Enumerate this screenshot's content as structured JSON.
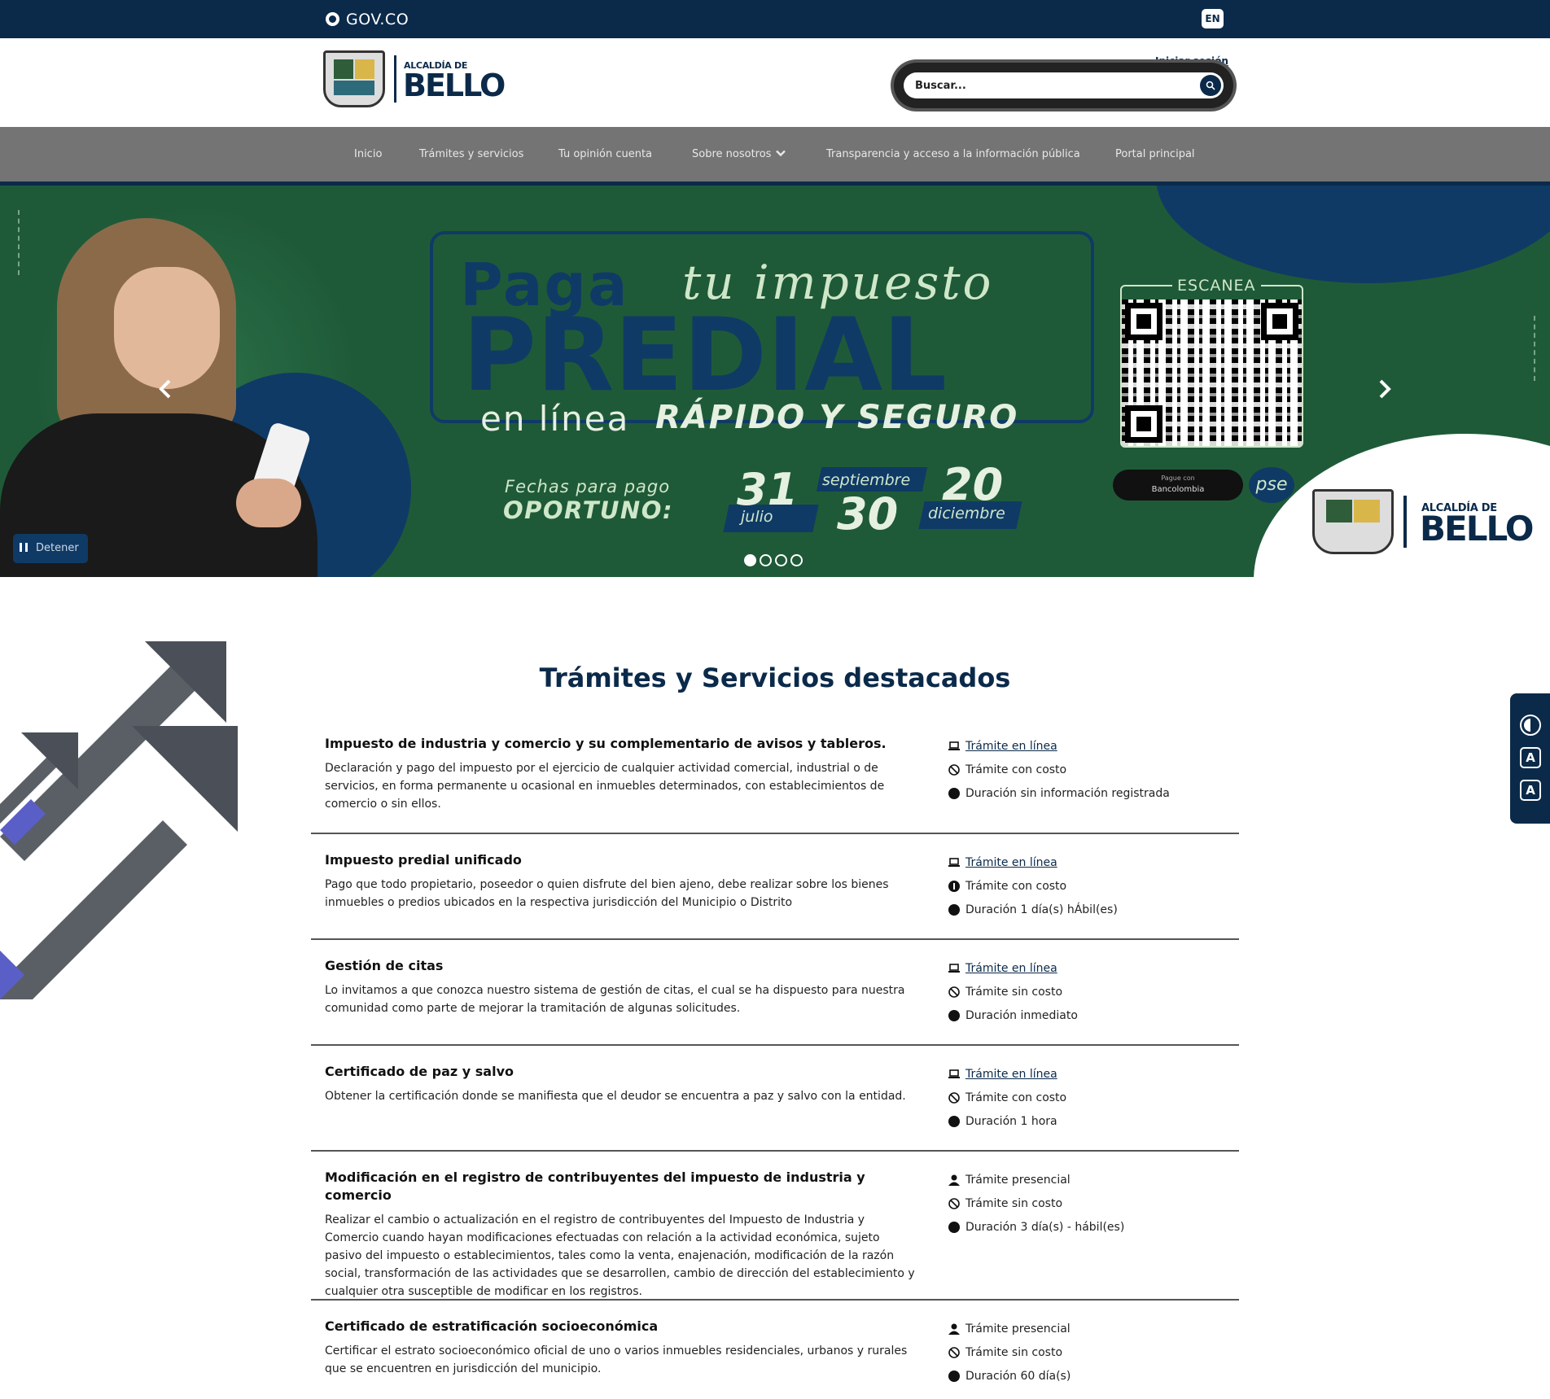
{
  "topbar": {
    "gov_label": "GOV.CO",
    "lang_label": "EN"
  },
  "header": {
    "brand_small": "ALCALDÍA DE",
    "brand_big": "BELLO",
    "login_label": "Iniciar sesión",
    "search_placeholder": "Buscar..."
  },
  "nav": {
    "items": [
      {
        "label": "Inicio"
      },
      {
        "label": "Trámites y servicios"
      },
      {
        "label": "Tu opinión cuenta"
      },
      {
        "label": "Sobre nosotros",
        "has_dropdown": true
      },
      {
        "label": "Transparencia y acceso a la información pública"
      },
      {
        "label": "Portal principal"
      }
    ]
  },
  "hero": {
    "headline_1": "Paga",
    "headline_2": "tu impuesto",
    "headline_3": "PREDIAL",
    "headline_4": "en línea",
    "headline_5": "RÁPIDO Y SEGURO",
    "dates_label_1": "Fechas para pago",
    "dates_label_2": "OPORTUNO:",
    "date_1_day": "31",
    "date_1_month": "julio",
    "date_2_month": "septiembre",
    "date_2_day": "30",
    "date_3_day": "20",
    "date_3_month": "diciembre",
    "qr_label": "ESCANEA",
    "pay_with": "Pague con",
    "bank": "Bancolombia",
    "pse": "pse",
    "brand_small": "ALCALDÍA DE",
    "brand_big": "BELLO",
    "pause_label": "Detener",
    "slides_total": 4,
    "slide_active": 1
  },
  "main": {
    "section_title": "Trámites y Servicios destacados",
    "services": [
      {
        "title": "Impuesto de industria y comercio y su complementario de avisos y tableros.",
        "description": "Declaración y pago del impuesto por el ejercicio de cualquier actividad comercial, industrial o de servicios, en forma permanente u ocasional en inmuebles determinados, con establecimientos de comercio o sin ellos.",
        "mode": "Trámite en línea",
        "mode_icon": "laptop-icon",
        "cost": "Trámite con costo",
        "duration": "Duración sin información registrada"
      },
      {
        "title": "Impuesto predial unificado",
        "description": "Pago que todo propietario, poseedor o quien disfrute del bien ajeno, debe realizar sobre los bienes inmuebles o predios ubicados en la respectiva jurisdicción del Municipio o Distrito",
        "mode": "Trámite en línea",
        "mode_icon": "laptop-icon",
        "cost": "Trámite con costo",
        "duration": "Duración 1 día(s) hÁbil(es)"
      },
      {
        "title": "Gestión de citas",
        "description": "Lo invitamos a que conozca nuestro sistema de gestión de citas, el cual se ha dispuesto para nuestra comunidad como parte de mejorar la tramitación de algunas solicitudes.",
        "mode": "Trámite en línea",
        "mode_icon": "laptop-icon",
        "cost": "Trámite sin costo",
        "duration": "Duración inmediato"
      },
      {
        "title": "Certificado de paz y salvo",
        "description": "Obtener la certificación donde se manifiesta que el deudor se encuentra a paz y salvo con la entidad.",
        "mode": "Trámite en línea",
        "mode_icon": "laptop-icon",
        "cost": "Trámite con costo",
        "duration": "Duración 1 hora"
      },
      {
        "title": "Modificación en el registro de contribuyentes del impuesto de industria y comercio",
        "description": "Realizar el cambio o actualización en el registro de contribuyentes del Impuesto de Industria y Comercio cuando hayan modificaciones efectuadas con relación a la actividad económica, sujeto pasivo del impuesto o establecimientos, tales como la venta, enajenación, modificación de la razón social, transformación de las actividades que se desarrollen, cambio de dirección del establecimiento y cualquier otra susceptible de modificar en los registros.",
        "mode": "Trámite presencial",
        "mode_icon": "person-icon",
        "cost": "Trámite sin costo",
        "duration": "Duración 3 día(s) - hábil(es)"
      },
      {
        "title": "Certificado de estratificación socioeconómica",
        "description": "Certificar el estrato socioeconómico oficial de uno o varios inmuebles residenciales, urbanos y rurales que se encuentren en jurisdicción del municipio.",
        "mode": "Trámite presencial",
        "mode_icon": "person-icon",
        "cost": "Trámite sin costo",
        "duration": "Duración 60 día(s)"
      }
    ]
  },
  "accessibility": {
    "contrast_icon": "contrast-icon",
    "decrease_label": "A",
    "increase_label": "A"
  },
  "colors": {
    "primary": "#0b2a4a",
    "nav_bg": "#747474",
    "hero_green": "#1f5a38"
  }
}
